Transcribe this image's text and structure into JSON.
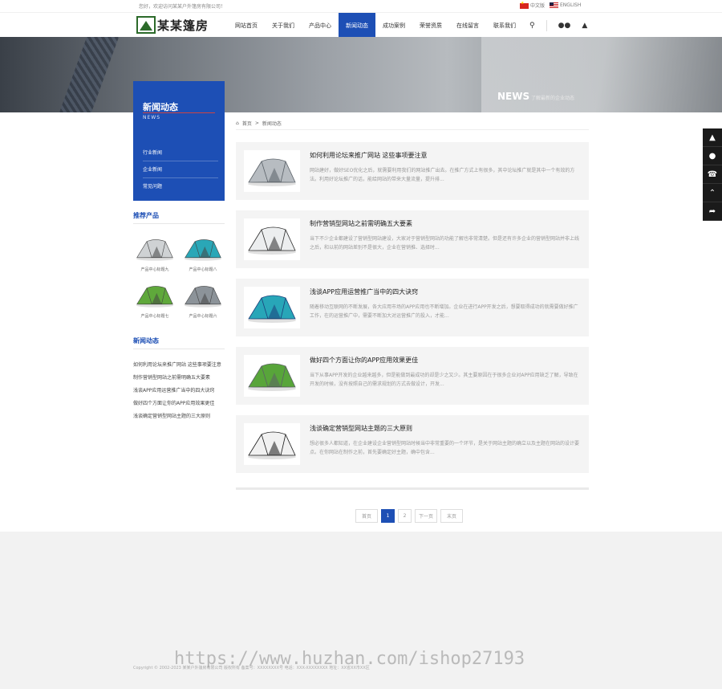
{
  "topbar": {
    "welcome": "您好，欢迎访问某某户外篷房有限公司！",
    "lang_cn": "中文版",
    "lang_en": "ENGLISH"
  },
  "header": {
    "logo_text": "某某篷房",
    "nav": [
      "网站首页",
      "关于我们",
      "产品中心",
      "新闻动态",
      "成功案例",
      "荣誉资质",
      "在线留言",
      "联系我们"
    ],
    "active_index": 3
  },
  "banner": {
    "title_en": "NEWS",
    "subtitle": "了解最新的企业动态"
  },
  "sidebar": {
    "title": "新闻动态",
    "title_en": "NEWS",
    "menu": [
      "行业新闻",
      "企业新闻",
      "常见问题"
    ],
    "products_title": "推荐产品",
    "products": [
      {
        "name": "产品中心标题九",
        "color": "#cfd2d4",
        "icon": "tent-white-icon"
      },
      {
        "name": "产品中心标题八",
        "color": "#2aa7b7",
        "icon": "tent-blue-icon"
      },
      {
        "name": "产品中心标题七",
        "color": "#5fa83b",
        "icon": "tent-green-icon"
      },
      {
        "name": "产品中心标题六",
        "color": "#8c9399",
        "icon": "tent-gray-icon"
      }
    ],
    "news_title": "新闻动态",
    "news": [
      "如何利用论坛来推广网站 这些事项要注意",
      "制作营销型网站之前需明确五大要素",
      "浅谈APP应用运营推广当中的四大诀窍",
      "做好四个方面让你的APP应用效果更佳",
      "浅谈确定营销型网站主题的三大原则"
    ]
  },
  "breadcrumb": {
    "home": "首页",
    "sep": ">",
    "current": "新闻动态"
  },
  "articles": [
    {
      "title": "如何利用论坛来推广网站 这些事项要注意",
      "desc": "网站建好，做好SEO优化之后，就需要利用我们的网站推广出去。在推广方式上有很多，其中论坛推广就是其中一个有效的方法。利用好论坛推广的话，能给网站的带来大量流量，提升排...",
      "tent": "gray"
    },
    {
      "title": "制作营销型网站之前需明确五大要素",
      "desc": "当下不少企业都建设了营销型网站建设，大家对于营销型网站的功能了解也非常清楚。但是还有许多企业的营销型网站并非上线之后，和以前的网站差别不是很大，企业在营销推、选择时...",
      "tent": "white"
    },
    {
      "title": "浅谈APP应用运营推广当中的四大诀窍",
      "desc": "随着移动互联网的不断发展，各大应用市场的APP应用也不断增加。企业在进行APP开发之后，想要取得成功的就需要做好推广工作，在的运营推广中，需要不断加大对运营推广的投入，才能...",
      "tent": "blue"
    },
    {
      "title": "做好四个方面让你的APP应用效果更佳",
      "desc": "当下从事APP开发的企业越来越多，但是能做到最成功的却是少之又少。其主要原因在于很多企业对APP应用缺乏了解，导致在开发的时候，没有按照自己的需求规划的方式去做设计，开发...",
      "tent": "green"
    },
    {
      "title": "浅谈确定营销型网站主题的三大原则",
      "desc": "想必很多人都知道，在企业建设企业营销型网站时候当中非常重要的一个环节，是关于网站主题的确立以及主题在网站的设计要点。在你网站在制作之前，首先要确定好主题，确中包含...",
      "tent": "black"
    }
  ],
  "pager": {
    "first": "首页",
    "pages": [
      "1",
      "2"
    ],
    "current": "1",
    "next": "下一页",
    "last": "末页"
  },
  "footer": {
    "copyright": "Copyright © 2002-2023 某某户外篷房有限公司 版权所有 备案号：XXXXXXXX号 电话：XXX-XXXXXXXX 地址：XX省XX市XX区"
  },
  "watermark": "https://www.huzhan.com/ishop27193",
  "float_bar": [
    "qq-icon",
    "wechat-icon",
    "phone-icon",
    "back-top-icon",
    "share-icon"
  ],
  "colors": {
    "accent": "#1d4fb5",
    "footer_bg": "#f2f2f2",
    "card_bg": "#f4f4f4"
  }
}
